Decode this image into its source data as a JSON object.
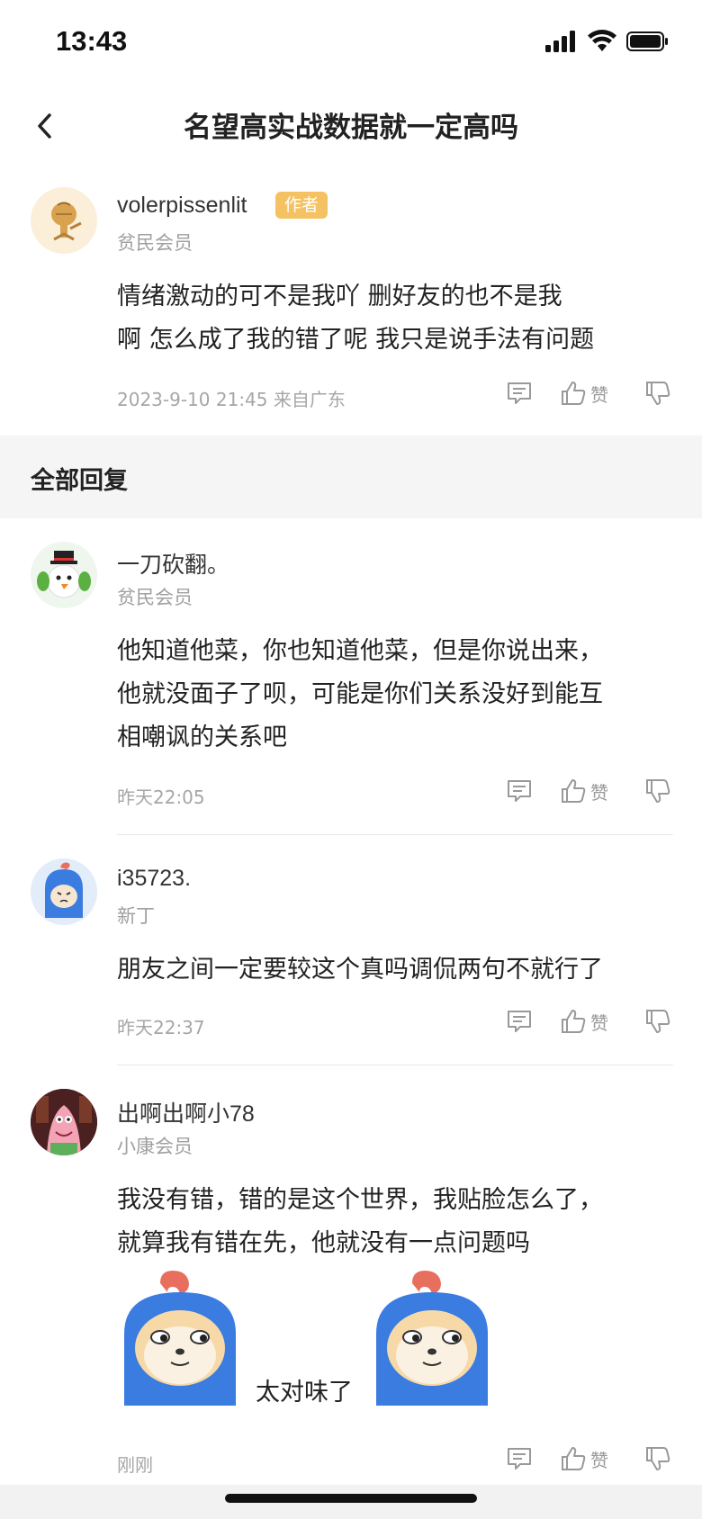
{
  "status": {
    "time": "13:43",
    "icons": [
      "signal-icon",
      "wifi-icon",
      "battery-icon"
    ]
  },
  "nav": {
    "back_icon": "chevron-left-icon",
    "title": "名望高实战数据就一定高吗"
  },
  "post": {
    "username": "volerpissenlit",
    "author_badge": "作者",
    "member_level": "贫民会员",
    "body_lines": [
      "情绪激动的可不是我吖  删好友的也不是我",
      "啊  怎么成了我的错了呢 我只是说手法有问题"
    ],
    "timestamp": "2023-9-10 21:45  来自广东",
    "like_label": "赞"
  },
  "section": {
    "title": "全部回复"
  },
  "replies": [
    {
      "username": "一刀砍翻。",
      "member_level": "贫民会员",
      "body_lines": [
        "他知道他菜，你也知道他菜，但是你说出来，",
        "他就没面子了呗，可能是你们关系没好到能互",
        "相嘲讽的关系吧"
      ],
      "timestamp": "昨天22:05",
      "like_label": "赞"
    },
    {
      "username": "i35723.",
      "member_level": "新丁",
      "body_lines": [
        "朋友之间一定要较这个真吗调侃两句不就行了"
      ],
      "timestamp": "昨天22:37",
      "like_label": "赞"
    },
    {
      "username": "出啊出啊小78",
      "member_level": "小康会员",
      "body_lines": [
        "我没有错，错的是这个世界，我贴脸怎么了，",
        "就算我有错在先，他就没有一点问题吗"
      ],
      "sticker_caption": "太对味了",
      "timestamp": "刚刚",
      "like_label": "赞"
    }
  ],
  "colors": {
    "badge": "#f4c262",
    "section_bg": "#f5f5f5",
    "meta_text": "#a6a6a6",
    "sticker_blue": "#3b7ce0",
    "sticker_red": "#e86f5e"
  }
}
